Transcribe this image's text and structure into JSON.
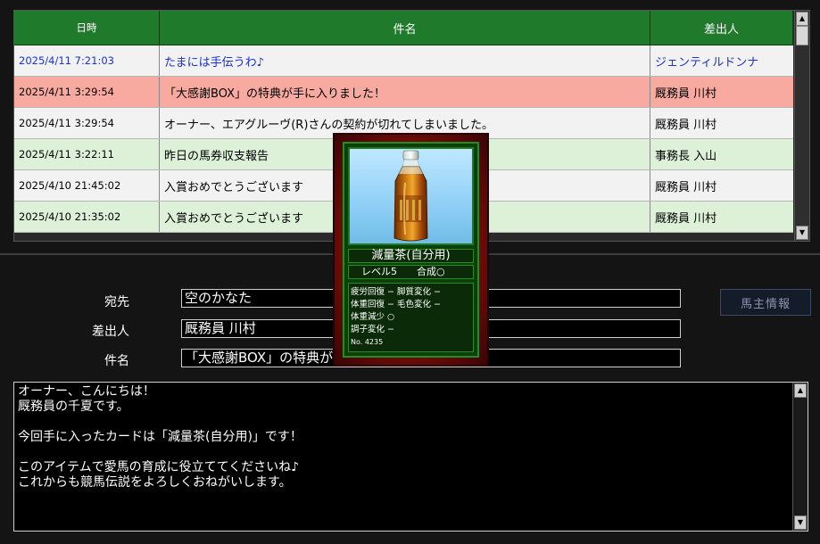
{
  "list": {
    "headers": {
      "date": "日時",
      "subject": "件名",
      "from": "差出人"
    },
    "rows": [
      {
        "date": "2025/4/11 7:21:03",
        "subject": "たまには手伝うわ♪",
        "from": "ジェンティルドンナ",
        "bg": "white",
        "unread": true
      },
      {
        "date": "2025/4/11 3:29:54",
        "subject": "「大感謝BOX」の特典が手に入りました！",
        "from": "厩務員 川村",
        "bg": "pink",
        "unread": false
      },
      {
        "date": "2025/4/11 3:29:54",
        "subject": "オーナー、エアグルーヴ(R)さんの契約が切れてしまいました。",
        "from": "厩務員 川村",
        "bg": "white",
        "unread": false
      },
      {
        "date": "2025/4/11 3:22:11",
        "subject": "昨日の馬券収支報告",
        "from": "事務長 入山",
        "bg": "green",
        "unread": false
      },
      {
        "date": "2025/4/10 21:45:02",
        "subject": "入賞おめでとうございます",
        "from": "厩務員 川村",
        "bg": "white",
        "unread": false
      },
      {
        "date": "2025/4/10 21:35:02",
        "subject": "入賞おめでとうございます",
        "from": "厩務員 川村",
        "bg": "green",
        "unread": false
      }
    ]
  },
  "detail": {
    "to_label": "宛先",
    "to_value": "空のかなた",
    "from_label": "差出人",
    "from_value": "厩務員 川村",
    "subject_label": "件名",
    "subject_value": "「大感謝BOX」の特典が手に入りました！",
    "owner_button": "馬主情報",
    "body_lines": [
      "オーナー、こんにちは！",
      "厩務員の千夏です。",
      "",
      "今回手に入ったカードは「減量茶(自分用)」です！",
      "",
      "このアイテムで愛馬の育成に役立ててくださいね♪",
      "これからも競馬伝説をよろしくおねがいします。"
    ]
  },
  "card": {
    "name": "減量茶(自分用)",
    "level": "レベル5",
    "synthesis": "合成○",
    "effects": [
      "疲労回復 − 脚質変化 −",
      "体重回復 − 毛色変化 −",
      "体重減少 ○",
      "調子変化 −"
    ],
    "number": "No. 4235",
    "image_icon": "tea-bottle-icon"
  },
  "colors": {
    "header_green": "#1f7a2b",
    "row_pink": "#f8aaa0",
    "row_green": "#ddf0d8",
    "unread_blue": "#1b30d8",
    "card_red": "#c02a1e",
    "card_frame_green": "#2a8a22"
  }
}
